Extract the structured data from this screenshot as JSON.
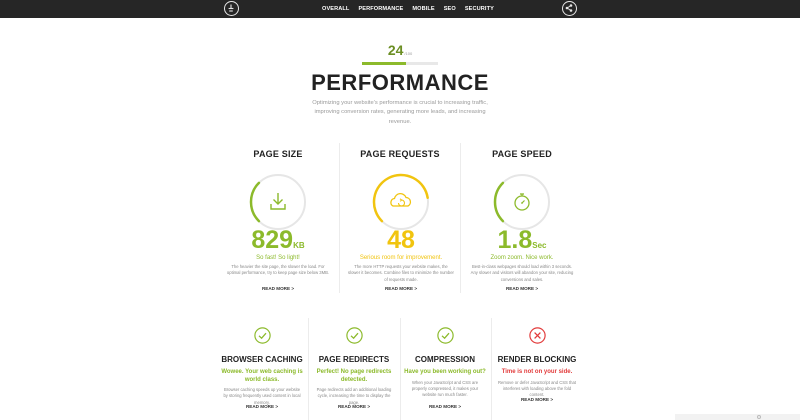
{
  "nav": {
    "items": [
      "OVERALL",
      "PERFORMANCE",
      "MOBILE",
      "SEO",
      "SECURITY"
    ]
  },
  "icons": {
    "left": "timer-icon",
    "right": "share-icon"
  },
  "score": {
    "value": "24",
    "out_of": "/100",
    "fill_fraction": 0.58
  },
  "header": {
    "title": "PERFORMANCE",
    "intro": "Optimizing your website's performance is crucial to increasing traffic, improving conversion rates, generating more leads, and increasing revenue."
  },
  "metrics": [
    {
      "title": "PAGE SIZE",
      "icon": "download-icon",
      "value": "829",
      "unit": "KB",
      "verdict": "So fast! So light!",
      "desc": "The heavier the site page, the slower the load. For optimal performance, try to keep page size below 3MB.",
      "more": "READ MORE >",
      "color": "#8cba2b",
      "gauge_fraction": 0.25
    },
    {
      "title": "PAGE REQUESTS",
      "icon": "cloud-upload-icon",
      "value": "48",
      "unit": "",
      "verdict": "Serious room for improvement.",
      "desc": "The more HTTP requests your website makes, the slower it becomes. Combine files to minimize the number of requests made.",
      "more": "READ MORE >",
      "color": "#f1c40f",
      "gauge_fraction": 0.6
    },
    {
      "title": "PAGE SPEED",
      "icon": "stopwatch-icon",
      "value": "1.8",
      "unit": "Sec",
      "verdict": "Zoom zoom. Nice work.",
      "desc": "Best-in-class webpages should load within 3 seconds. Any slower and visitors will abandon your site, reducing conversions and sales.",
      "more": "READ MORE >",
      "color": "#8cba2b",
      "gauge_fraction": 0.25
    }
  ],
  "checks": [
    {
      "title": "BROWSER CACHING",
      "status": "pass",
      "sub": "Wowee. Your web caching is world class.",
      "txt": "Browser caching speeds up your website by storing frequently used content in local memory.",
      "more": "READ MORE >",
      "color": "#8cba2b"
    },
    {
      "title": "PAGE REDIRECTS",
      "status": "pass",
      "sub": "Perfect! No page redirects detected.",
      "txt": "Page redirects add an additional loading cycle, increasing the time to display the page.",
      "more": "READ MORE >",
      "color": "#8cba2b"
    },
    {
      "title": "COMPRESSION",
      "status": "pass",
      "sub": "Have you been working out?",
      "txt": "When your JavaScript and CSS are properly compressed, it makes your website run much faster.",
      "more": "READ MORE >",
      "color": "#8cba2b"
    },
    {
      "title": "RENDER BLOCKING",
      "status": "fail",
      "sub": "Time is not on your side.",
      "txt": "Remove or defer JavaScript and CSS that interferes with loading above the fold content.",
      "more": "READ MORE >",
      "color": "#e23b3b"
    }
  ]
}
